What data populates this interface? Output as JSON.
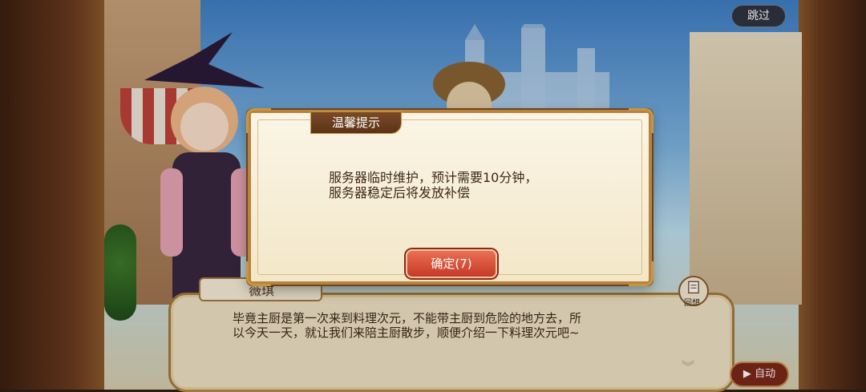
{
  "top_bar": {
    "skip_label": "跳过"
  },
  "modal": {
    "title": "温馨提示",
    "message_line1": "服务器临时维护，预计需要10分钟，",
    "message_line2": "服务器稳定后将发放补偿",
    "confirm_label": "确定(7)"
  },
  "dialogue": {
    "speaker": "薇琪",
    "line1": "毕竟主厨是第一次来到料理次元，不能带主厨到危险的地方去，所",
    "line2": "以今天一天，就让我们来陪主厨散步，顺便介绍一下料理次元吧~",
    "log_label": "回想",
    "auto_label": "自动",
    "scroll_icon": "double-chevron-down"
  },
  "icons": {
    "log": "scroll-icon",
    "auto": "play-icon"
  },
  "colors": {
    "confirm_button": "#d9503a",
    "title_tab": "#6b3d1e",
    "frame_gold": "#b8843d"
  }
}
